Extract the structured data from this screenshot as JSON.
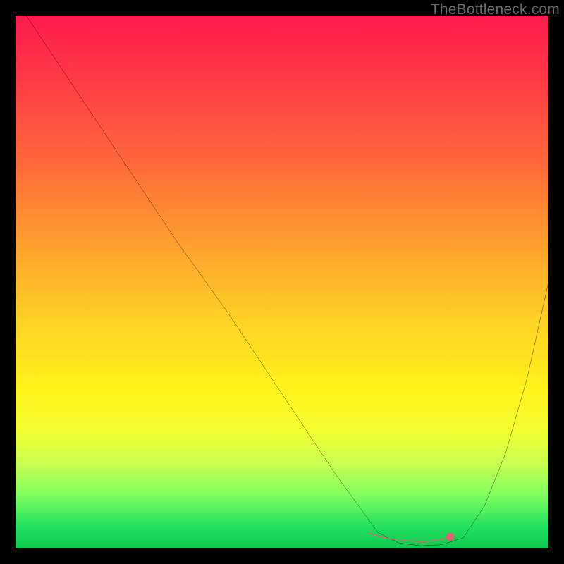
{
  "watermark": "TheBottleneck.com",
  "chart_data": {
    "type": "line",
    "title": "",
    "xlabel": "",
    "ylabel": "",
    "xlim": [
      0,
      100
    ],
    "ylim": [
      0,
      100
    ],
    "grid": false,
    "curve": {
      "stroke": "#000000",
      "x": [
        2,
        10,
        20,
        30,
        40,
        50,
        60,
        68,
        72,
        76,
        80,
        84,
        88,
        92,
        96,
        100
      ],
      "y": [
        100,
        88,
        73,
        58,
        44,
        29,
        14,
        3,
        1,
        0.5,
        0.7,
        2,
        8,
        18,
        32,
        50
      ]
    },
    "flat_zone": {
      "stroke": "#d9666d",
      "x": [
        66,
        68,
        70,
        72,
        74,
        76,
        78,
        80,
        81.5
      ],
      "y": [
        3.0,
        2.4,
        1.9,
        1.6,
        1.4,
        1.3,
        1.4,
        1.8,
        2.2
      ]
    },
    "flat_zone_endpoint": {
      "x": 81.5,
      "y": 2.2,
      "r": 5,
      "fill": "#d9666d"
    },
    "background_gradient_stops": [
      {
        "pos": 0,
        "hex": "#ff1a4d"
      },
      {
        "pos": 12,
        "hex": "#ff3a46"
      },
      {
        "pos": 28,
        "hex": "#ff6a3a"
      },
      {
        "pos": 44,
        "hex": "#ffa42e"
      },
      {
        "pos": 58,
        "hex": "#ffd424"
      },
      {
        "pos": 70,
        "hex": "#fff21a"
      },
      {
        "pos": 78,
        "hex": "#f2ff30"
      },
      {
        "pos": 84,
        "hex": "#c8ff50"
      },
      {
        "pos": 90,
        "hex": "#7fff60"
      },
      {
        "pos": 96,
        "hex": "#20e060"
      },
      {
        "pos": 100,
        "hex": "#10c850"
      }
    ]
  }
}
